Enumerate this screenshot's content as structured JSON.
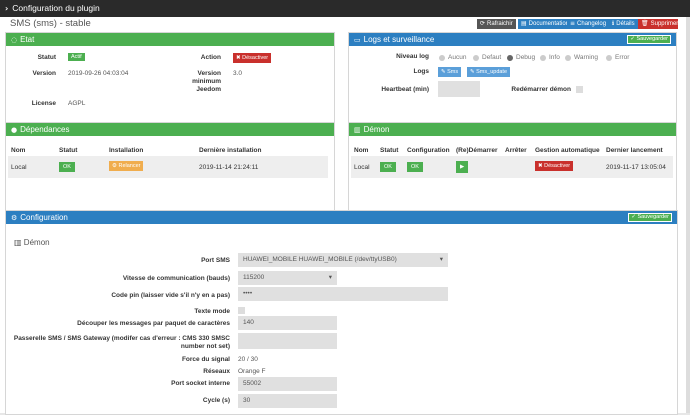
{
  "window": {
    "title": "Configuration du plugin"
  },
  "plugin": {
    "subtitle": "SMS (sms) - stable"
  },
  "toolbar": {
    "refresh": "Rafraichir",
    "documentation": "Documentation",
    "changelog": "Changelog",
    "details": "Détails",
    "delete": "Supprimer"
  },
  "etat": {
    "title": "Etat",
    "statut_label": "Statut",
    "statut_value": "Actif",
    "action_label": "Action",
    "action_button": "Désactiver",
    "version_label": "Version",
    "version_value": "2019-09-26 04:03:04",
    "version_min_label_1": "Version",
    "version_min_label_2": "minimum",
    "version_min_label_3": "Jeedom",
    "version_min_value": "3.0",
    "license_label": "License",
    "license_value": "AGPL"
  },
  "logs": {
    "title": "Logs et surveillance",
    "save": "Sauvegarder",
    "niveau_label": "Niveau log",
    "levels": [
      "Aucun",
      "Defaut",
      "Debug",
      "Info",
      "Warning",
      "Error"
    ],
    "selected_level": "Debug",
    "logs_label": "Logs",
    "log_buttons": [
      "Sms",
      "Sms_update"
    ],
    "heartbeat_label": "Heartbeat (min)",
    "heartbeat_value": "",
    "restart_label": "Redémarrer démon"
  },
  "deps": {
    "title": "Dépendances",
    "headers": [
      "Nom",
      "Statut",
      "Installation",
      "Dernière installation"
    ],
    "row": {
      "nom": "Local",
      "statut": "OK",
      "install": "Relancer",
      "last": "2019-11-14 21:24:11"
    }
  },
  "demon": {
    "title": "Démon",
    "headers": [
      "Nom",
      "Statut",
      "Configuration",
      "(Re)Démarrer",
      "Arrêter",
      "Gestion automatique",
      "Dernier lancement"
    ],
    "row": {
      "nom": "Local",
      "statut": "OK",
      "config": "OK",
      "gestion": "Désactiver",
      "last": "2019-11-17 13:05:04"
    }
  },
  "config": {
    "title": "Configuration",
    "save": "Sauvegarder",
    "section": "Démon",
    "port_label": "Port SMS",
    "port_value": "HUAWEI_MOBILE HUAWEI_MOBILE (/dev/ttyUSB0)",
    "speed_label": "Vitesse de communication (bauds)",
    "speed_value": "115200",
    "pin_label": "Code pin (laisser vide s'il n'y en a pas)",
    "pin_value": "••••",
    "text_mode_label": "Texte mode",
    "split_label": "Découper les messages par paquet de caractères",
    "split_value": "140",
    "gateway_label_1": "Passerelle SMS / SMS Gateway (modifer cas d'erreur : CMS 330 SMSC",
    "gateway_label_2": "number not set)",
    "gateway_value": "",
    "signal_label": "Force du signal",
    "signal_value": "20 / 30",
    "network_label": "Réseaux",
    "network_value": "Orange F",
    "socket_label": "Port socket interne",
    "socket_value": "55002",
    "cycle_label": "Cycle (s)",
    "cycle_value": "30"
  }
}
